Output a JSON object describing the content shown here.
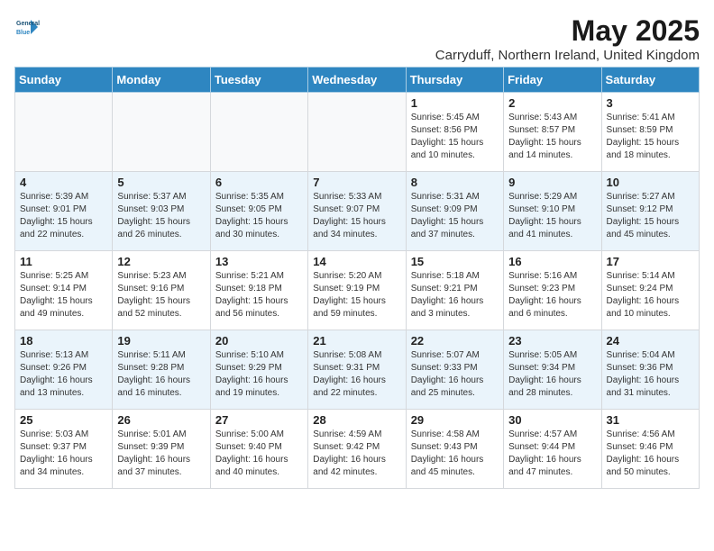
{
  "header": {
    "logo_line1": "General",
    "logo_line2": "Blue",
    "title": "May 2025",
    "subtitle": "Carryduff, Northern Ireland, United Kingdom"
  },
  "weekdays": [
    "Sunday",
    "Monday",
    "Tuesday",
    "Wednesday",
    "Thursday",
    "Friday",
    "Saturday"
  ],
  "weeks": [
    [
      {
        "day": "",
        "info": ""
      },
      {
        "day": "",
        "info": ""
      },
      {
        "day": "",
        "info": ""
      },
      {
        "day": "",
        "info": ""
      },
      {
        "day": "1",
        "info": "Sunrise: 5:45 AM\nSunset: 8:56 PM\nDaylight: 15 hours\nand 10 minutes."
      },
      {
        "day": "2",
        "info": "Sunrise: 5:43 AM\nSunset: 8:57 PM\nDaylight: 15 hours\nand 14 minutes."
      },
      {
        "day": "3",
        "info": "Sunrise: 5:41 AM\nSunset: 8:59 PM\nDaylight: 15 hours\nand 18 minutes."
      }
    ],
    [
      {
        "day": "4",
        "info": "Sunrise: 5:39 AM\nSunset: 9:01 PM\nDaylight: 15 hours\nand 22 minutes."
      },
      {
        "day": "5",
        "info": "Sunrise: 5:37 AM\nSunset: 9:03 PM\nDaylight: 15 hours\nand 26 minutes."
      },
      {
        "day": "6",
        "info": "Sunrise: 5:35 AM\nSunset: 9:05 PM\nDaylight: 15 hours\nand 30 minutes."
      },
      {
        "day": "7",
        "info": "Sunrise: 5:33 AM\nSunset: 9:07 PM\nDaylight: 15 hours\nand 34 minutes."
      },
      {
        "day": "8",
        "info": "Sunrise: 5:31 AM\nSunset: 9:09 PM\nDaylight: 15 hours\nand 37 minutes."
      },
      {
        "day": "9",
        "info": "Sunrise: 5:29 AM\nSunset: 9:10 PM\nDaylight: 15 hours\nand 41 minutes."
      },
      {
        "day": "10",
        "info": "Sunrise: 5:27 AM\nSunset: 9:12 PM\nDaylight: 15 hours\nand 45 minutes."
      }
    ],
    [
      {
        "day": "11",
        "info": "Sunrise: 5:25 AM\nSunset: 9:14 PM\nDaylight: 15 hours\nand 49 minutes."
      },
      {
        "day": "12",
        "info": "Sunrise: 5:23 AM\nSunset: 9:16 PM\nDaylight: 15 hours\nand 52 minutes."
      },
      {
        "day": "13",
        "info": "Sunrise: 5:21 AM\nSunset: 9:18 PM\nDaylight: 15 hours\nand 56 minutes."
      },
      {
        "day": "14",
        "info": "Sunrise: 5:20 AM\nSunset: 9:19 PM\nDaylight: 15 hours\nand 59 minutes."
      },
      {
        "day": "15",
        "info": "Sunrise: 5:18 AM\nSunset: 9:21 PM\nDaylight: 16 hours\nand 3 minutes."
      },
      {
        "day": "16",
        "info": "Sunrise: 5:16 AM\nSunset: 9:23 PM\nDaylight: 16 hours\nand 6 minutes."
      },
      {
        "day": "17",
        "info": "Sunrise: 5:14 AM\nSunset: 9:24 PM\nDaylight: 16 hours\nand 10 minutes."
      }
    ],
    [
      {
        "day": "18",
        "info": "Sunrise: 5:13 AM\nSunset: 9:26 PM\nDaylight: 16 hours\nand 13 minutes."
      },
      {
        "day": "19",
        "info": "Sunrise: 5:11 AM\nSunset: 9:28 PM\nDaylight: 16 hours\nand 16 minutes."
      },
      {
        "day": "20",
        "info": "Sunrise: 5:10 AM\nSunset: 9:29 PM\nDaylight: 16 hours\nand 19 minutes."
      },
      {
        "day": "21",
        "info": "Sunrise: 5:08 AM\nSunset: 9:31 PM\nDaylight: 16 hours\nand 22 minutes."
      },
      {
        "day": "22",
        "info": "Sunrise: 5:07 AM\nSunset: 9:33 PM\nDaylight: 16 hours\nand 25 minutes."
      },
      {
        "day": "23",
        "info": "Sunrise: 5:05 AM\nSunset: 9:34 PM\nDaylight: 16 hours\nand 28 minutes."
      },
      {
        "day": "24",
        "info": "Sunrise: 5:04 AM\nSunset: 9:36 PM\nDaylight: 16 hours\nand 31 minutes."
      }
    ],
    [
      {
        "day": "25",
        "info": "Sunrise: 5:03 AM\nSunset: 9:37 PM\nDaylight: 16 hours\nand 34 minutes."
      },
      {
        "day": "26",
        "info": "Sunrise: 5:01 AM\nSunset: 9:39 PM\nDaylight: 16 hours\nand 37 minutes."
      },
      {
        "day": "27",
        "info": "Sunrise: 5:00 AM\nSunset: 9:40 PM\nDaylight: 16 hours\nand 40 minutes."
      },
      {
        "day": "28",
        "info": "Sunrise: 4:59 AM\nSunset: 9:42 PM\nDaylight: 16 hours\nand 42 minutes."
      },
      {
        "day": "29",
        "info": "Sunrise: 4:58 AM\nSunset: 9:43 PM\nDaylight: 16 hours\nand 45 minutes."
      },
      {
        "day": "30",
        "info": "Sunrise: 4:57 AM\nSunset: 9:44 PM\nDaylight: 16 hours\nand 47 minutes."
      },
      {
        "day": "31",
        "info": "Sunrise: 4:56 AM\nSunset: 9:46 PM\nDaylight: 16 hours\nand 50 minutes."
      }
    ]
  ]
}
